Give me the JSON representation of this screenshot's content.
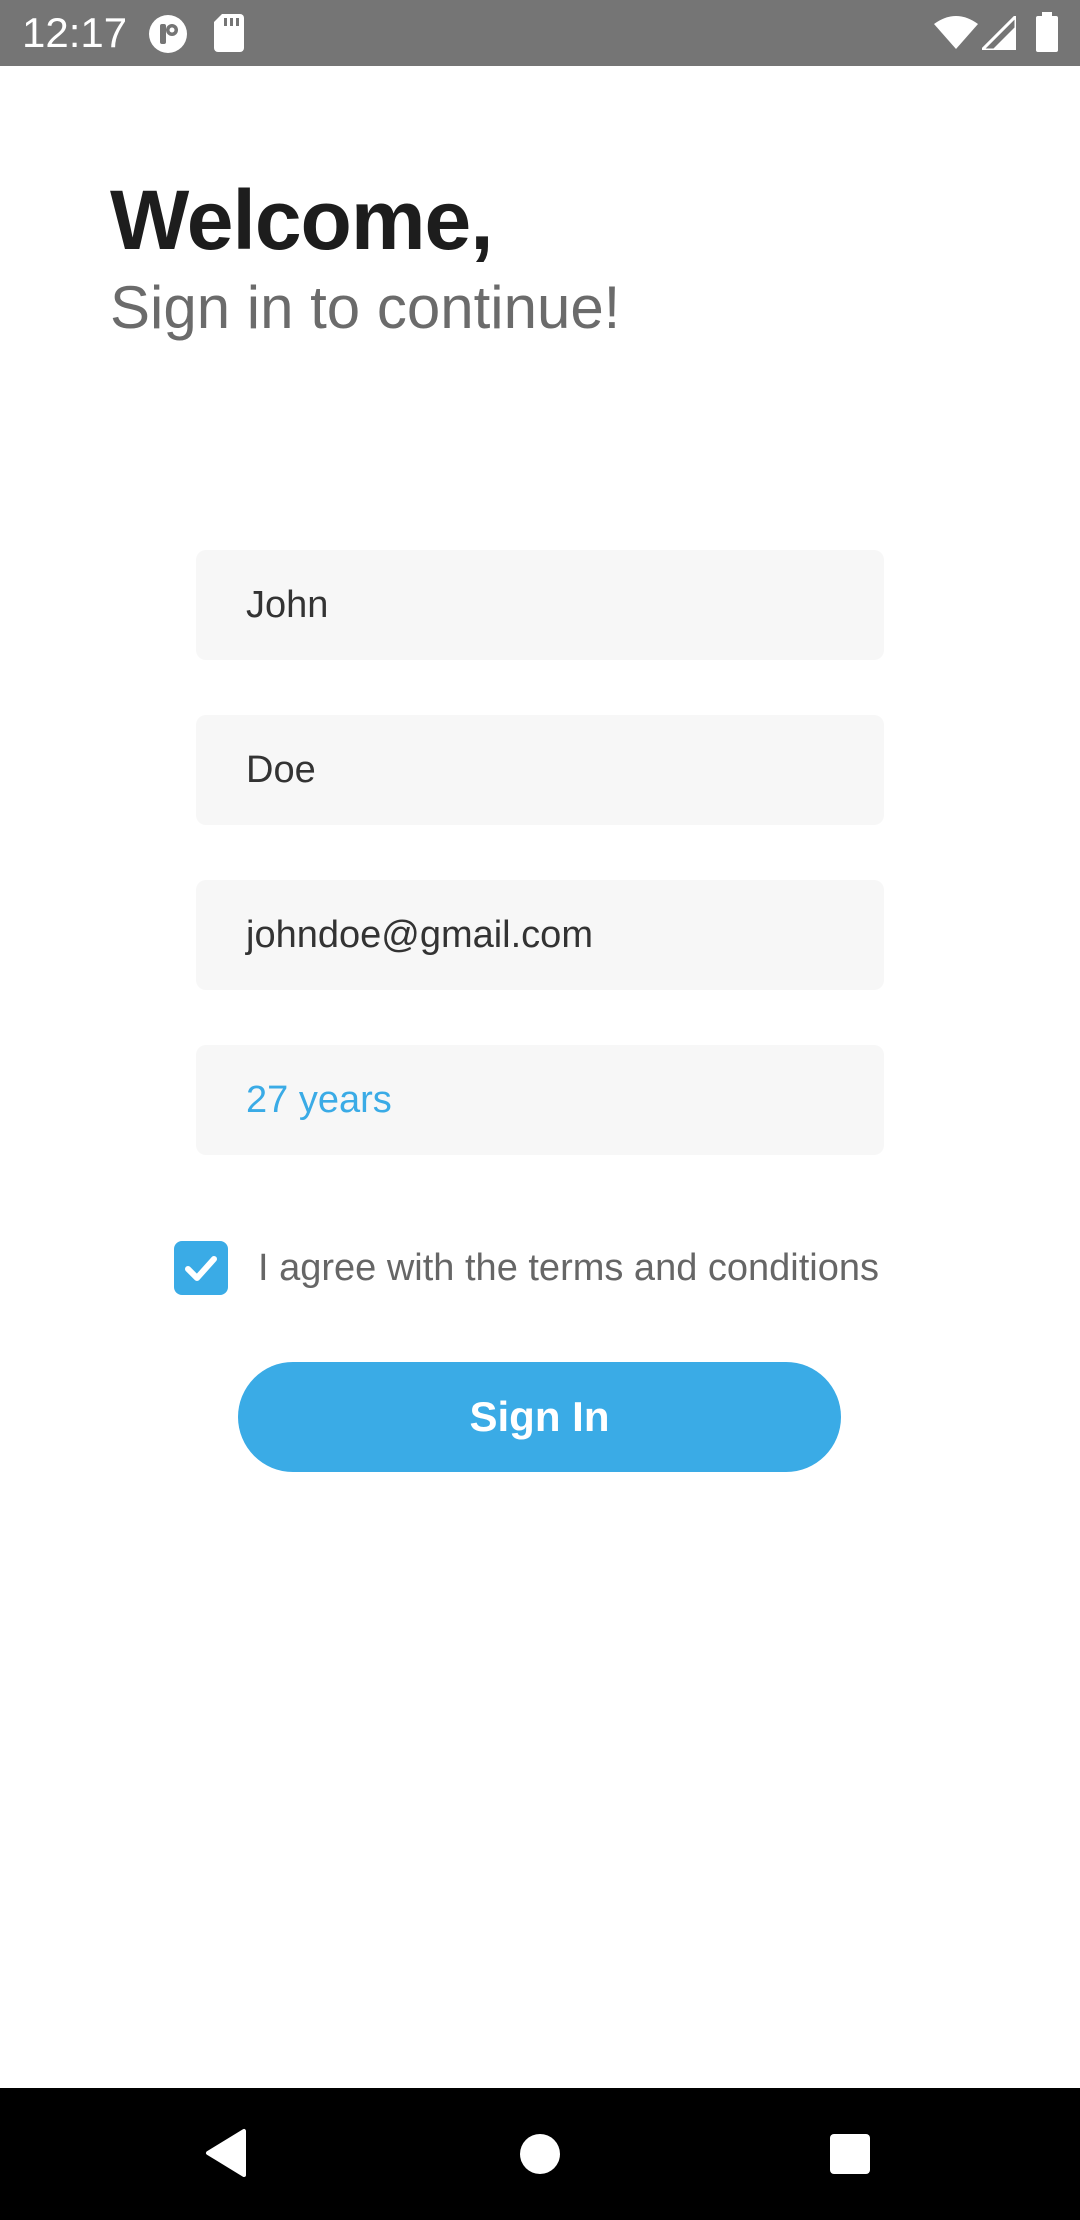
{
  "status_bar": {
    "time": "12:17",
    "icons": [
      "app-notification-icon",
      "sd-card-icon",
      "wifi-icon",
      "cellular-signal-icon",
      "battery-icon"
    ]
  },
  "header": {
    "title": "Welcome,",
    "subtitle": "Sign in to continue!"
  },
  "form": {
    "first_name": "John",
    "last_name": "Doe",
    "email": "johndoe@gmail.com",
    "age": "27 years",
    "terms_checked": true,
    "terms_label": "I agree with the terms and conditions",
    "submit_label": "Sign In"
  },
  "nav_bar": {
    "buttons": [
      "back-icon",
      "home-icon",
      "recents-icon"
    ]
  },
  "colors": {
    "accent": "#3aabe6",
    "status_bar": "#757575",
    "field_bg": "#f7f7f7",
    "title": "#1d1d1d",
    "subtitle": "#6b6b6b"
  }
}
